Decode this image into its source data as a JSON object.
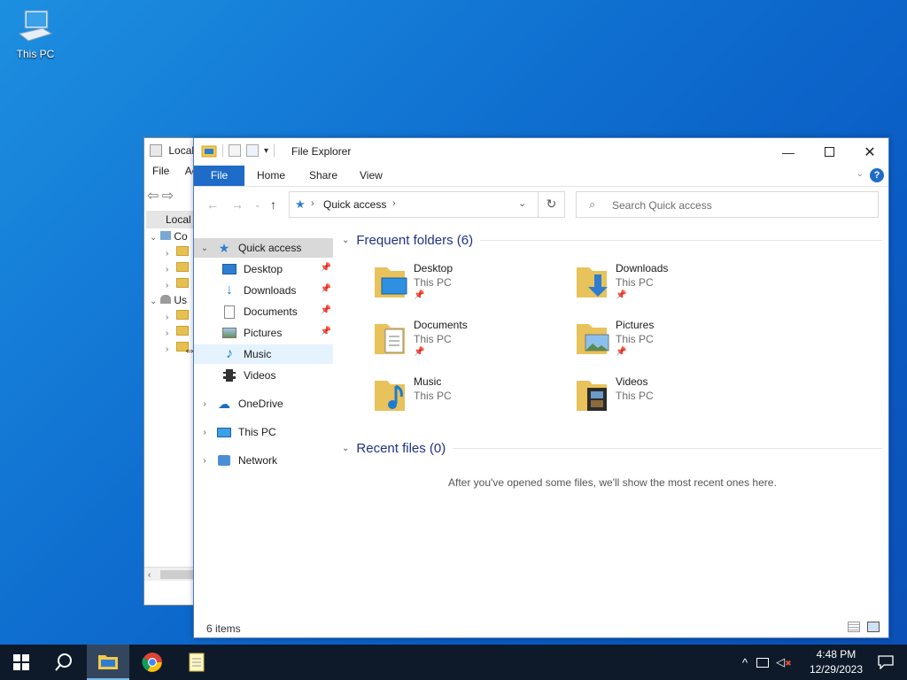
{
  "desktop": {
    "icons": [
      {
        "label": "This PC",
        "icon": "computer-icon"
      }
    ]
  },
  "background_window": {
    "title": "Local",
    "menu": [
      "File",
      "Ac"
    ],
    "tree_selected": "Local",
    "tree_nodes": [
      "Co",
      "Us"
    ]
  },
  "explorer": {
    "title": "File Explorer",
    "ribbon_tabs": [
      "File",
      "Home",
      "Share",
      "View"
    ],
    "address": {
      "segments": [
        "Quick access"
      ]
    },
    "search": {
      "placeholder": "Search Quick access"
    },
    "nav": {
      "quick_access": "Quick access",
      "pinned": [
        {
          "label": "Desktop",
          "icon": "desktop-icon",
          "pinned": true
        },
        {
          "label": "Downloads",
          "icon": "download-arrow-icon",
          "pinned": true
        },
        {
          "label": "Documents",
          "icon": "document-icon",
          "pinned": true
        },
        {
          "label": "Pictures",
          "icon": "picture-icon",
          "pinned": true
        },
        {
          "label": "Music",
          "icon": "music-note-icon",
          "pinned": false
        },
        {
          "label": "Videos",
          "icon": "film-icon",
          "pinned": false
        }
      ],
      "roots": [
        {
          "label": "OneDrive",
          "icon": "cloud-icon"
        },
        {
          "label": "This PC",
          "icon": "monitor-icon"
        },
        {
          "label": "Network",
          "icon": "network-icon"
        }
      ]
    },
    "frequent": {
      "header": "Frequent folders (6)",
      "folders": [
        {
          "name": "Desktop",
          "location": "This PC",
          "pinned": true
        },
        {
          "name": "Downloads",
          "location": "This PC",
          "pinned": true
        },
        {
          "name": "Documents",
          "location": "This PC",
          "pinned": true
        },
        {
          "name": "Pictures",
          "location": "This PC",
          "pinned": true
        },
        {
          "name": "Music",
          "location": "This PC",
          "pinned": false
        },
        {
          "name": "Videos",
          "location": "This PC",
          "pinned": false
        }
      ]
    },
    "recent": {
      "header": "Recent files (0)",
      "empty_message": "After you've opened some files, we'll show the most recent ones here."
    },
    "status": "6 items"
  },
  "taskbar": {
    "time": "4:48 PM",
    "date": "12/29/2023",
    "colors": {
      "bar": "#0e1a2a",
      "accent": "#1e6bc8"
    }
  }
}
